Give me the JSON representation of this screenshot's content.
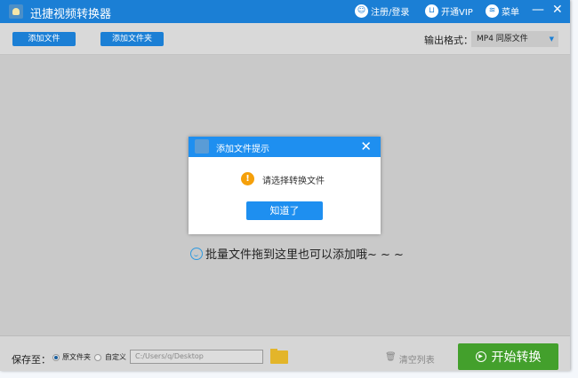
{
  "app": {
    "title": "迅捷视频转换器"
  },
  "titlebar": {
    "login": "注册/登录",
    "vip": "开通VIP",
    "menu": "菜单",
    "minimize": "—",
    "close": "✕"
  },
  "toolbar": {
    "add_file": "添加文件",
    "add_folder": "添加文件夹",
    "format_label": "输出格式：",
    "format_value": "MP4  同原文件"
  },
  "main": {
    "drop_hint": "批量文件拖到这里也可以添加哦~ ~ ~"
  },
  "dialog": {
    "title": "添加文件提示",
    "message": "请选择转换文件",
    "ok": "知道了",
    "close": "✕",
    "warn_icon": "!"
  },
  "bottom": {
    "save_label": "保存至：",
    "option_original": "原文件夹",
    "option_custom": "自定义",
    "selected": "原文件夹",
    "path": "C:/Users/q/Desktop",
    "clear": "清空列表",
    "start": "开始转换"
  },
  "colors": {
    "titlebar": "#1b7fd5",
    "dialog_accent": "#1e8ff0",
    "start": "#43a02c",
    "warning": "#f5a00a"
  }
}
